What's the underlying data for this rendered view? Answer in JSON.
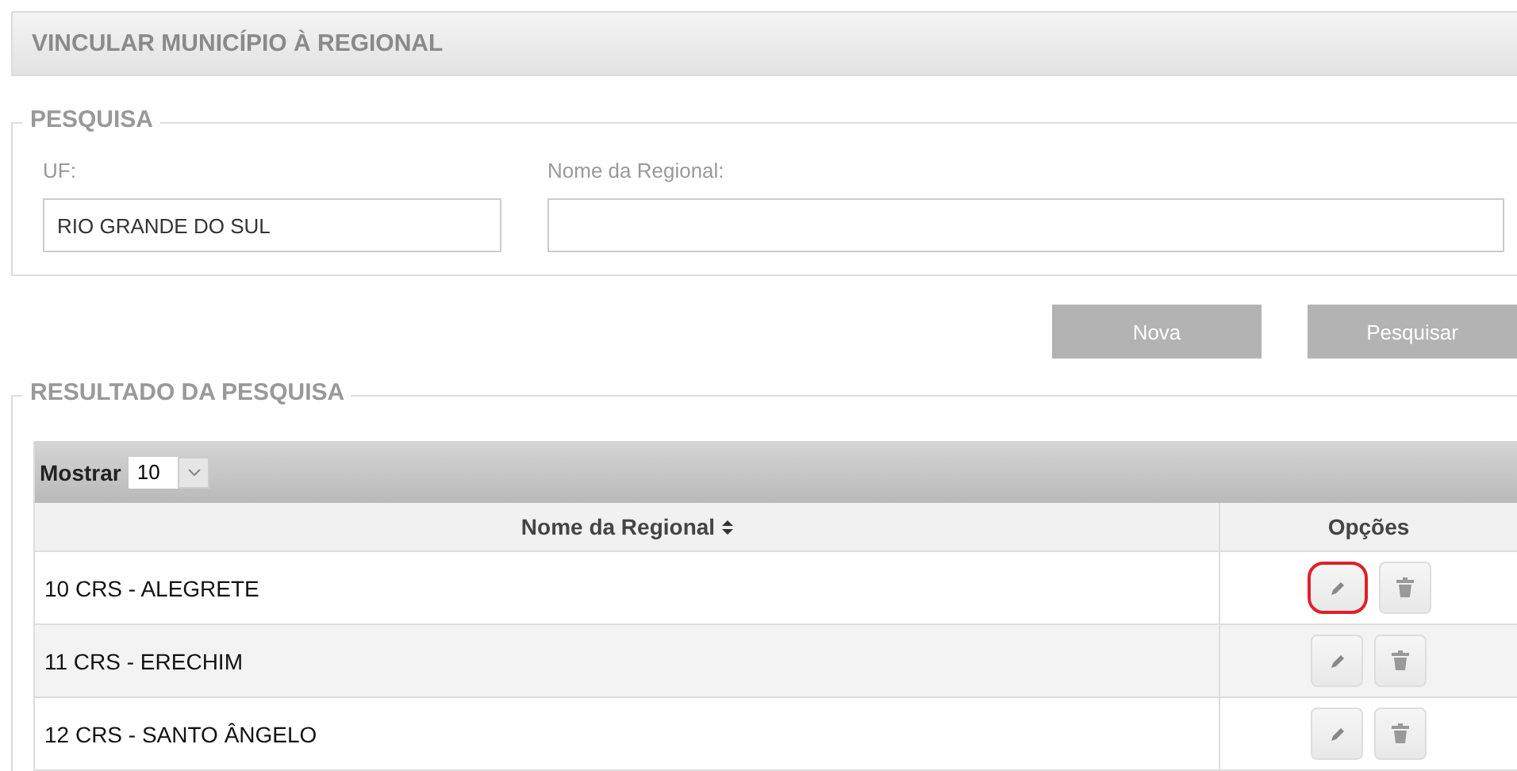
{
  "page_title": "VINCULAR MUNICÍPIO À REGIONAL",
  "search": {
    "legend": "PESQUISA",
    "fields": [
      {
        "label": "UF:",
        "value": "RIO GRANDE DO SUL"
      },
      {
        "label": "Nome da Regional:"
      }
    ]
  },
  "buttons": [
    "Nova",
    "Pesquisar"
  ],
  "results": {
    "legend": "RESULTADO DA PESQUISA",
    "page_size_label": "Mostrar",
    "page_size": "10",
    "columns": [
      {
        "label": "Nome da Regional",
        "sortable": true
      },
      {
        "label": "Opções",
        "sortable": false
      }
    ],
    "rows": [
      {
        "name": "10 CRS - ALEGRETE",
        "highlighted": true
      },
      {
        "name": "11 CRS - ERECHIM",
        "highlighted": false
      },
      {
        "name": "12 CRS - SANTO ÂNGELO",
        "highlighted": false
      }
    ]
  }
}
